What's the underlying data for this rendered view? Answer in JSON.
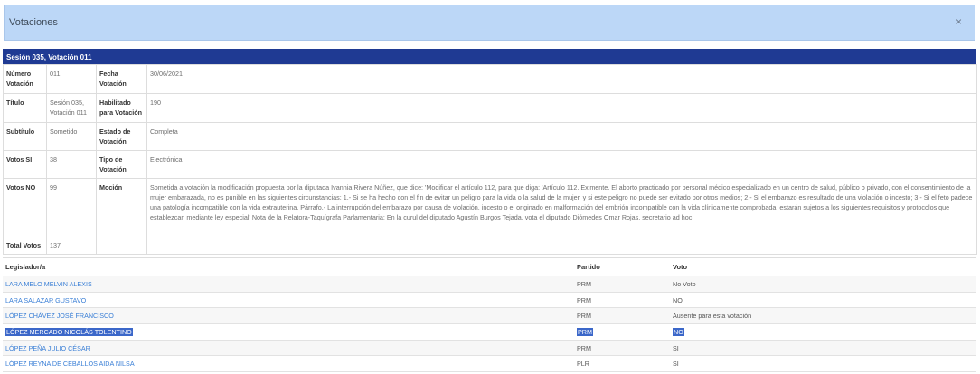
{
  "modal": {
    "title": "Votaciones",
    "close_label": "×"
  },
  "session_header": "Sesión 035, Votación 011",
  "details": {
    "numero_label": "Número Votación",
    "numero_value": "011",
    "fecha_label": "Fecha Votación",
    "fecha_value": "30/06/2021",
    "titulo_label": "Título",
    "titulo_value": "Sesión 035, Votación 011",
    "habilitado_label": "Habilitado para Votación",
    "habilitado_value": "190",
    "subtitulo_label": "Subtítulo",
    "subtitulo_value": "Sometido",
    "estado_label": "Estado de Votación",
    "estado_value": "Completa",
    "votos_si_label": "Votos SI",
    "votos_si_value": "38",
    "tipo_label": "Tipo de Votación",
    "tipo_value": "Electrónica",
    "votos_no_label": "Votos NO",
    "votos_no_value": "99",
    "mocion_label": "Moción",
    "mocion_value": "Sometida a votación la modificación propuesta por la diputada Ivannia Rivera Núñez, que dice: 'Modificar el artículo 112, para que diga: 'Artículo 112. Eximente. El aborto practicado por personal médico especializado en un centro de salud, público o privado, con el consentimiento de la mujer embarazada, no es punible en las siguientes circunstancias: 1.- Si se ha hecho con el fin de evitar un peligro para la vida o la salud de la mujer, y si este peligro no puede ser evitado por otros medios; 2.- Si el embarazo es resultado de una violación o incesto; 3.- Si el feto padece una patología incompatible con la vida extrauterina. Párrafo.- La interrupción del embarazo por causa de violación, incesto o el originado en malformación del embrión incompatible con la vida clínicamente comprobada, estarán sujetos a los siguientes requisitos y protocolos que establezcan mediante ley especial' Nota de la Relatora-Taquígrafa Parlamentaria: En la curul del diputado Agustín Burgos Tejada, vota el diputado Diómedes Omar Rojas, secretario ad hoc.",
    "total_label": "Total Votos",
    "total_value": "137"
  },
  "votes_table": {
    "headers": {
      "legislador": "Legislador/a",
      "partido": "Partido",
      "voto": "Voto"
    },
    "rows": [
      {
        "name": "LARA MELO MELVIN ALEXIS",
        "party": "PRM",
        "vote": "No Voto"
      },
      {
        "name": "LARA SALAZAR GUSTAVO",
        "party": "PRM",
        "vote": "NO"
      },
      {
        "name": "LÓPEZ CHÁVEZ JOSÉ FRANCISCO",
        "party": "PRM",
        "vote": "Ausente para esta votación"
      },
      {
        "name": "LÓPEZ MERCADO NICOLÁS TOLENTINO",
        "party": "PRM",
        "vote": "NO"
      },
      {
        "name": "LÓPEZ PEÑA JULIO CÉSAR",
        "party": "PRM",
        "vote": "SI"
      },
      {
        "name": "LÓPEZ REYNA DE CEBALLOS AIDA NILSA",
        "party": "PLR",
        "vote": "SI"
      }
    ]
  },
  "colors": {
    "header_bg": "#bcd7f7",
    "session_bar": "#1f3a93",
    "link": "#3a7fd6",
    "selection": "#3b67c9"
  }
}
